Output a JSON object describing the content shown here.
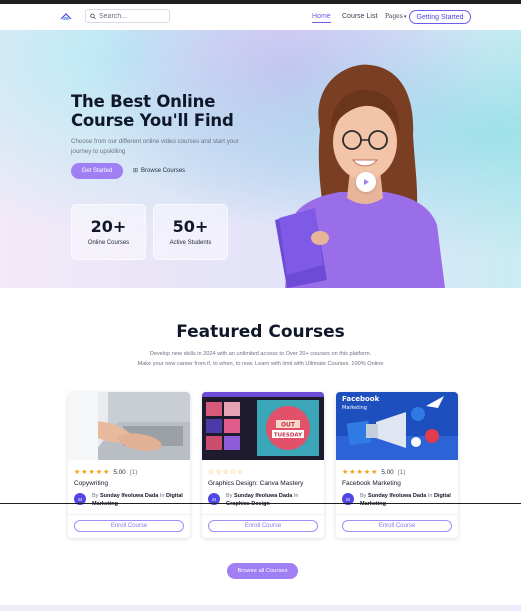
{
  "nav": {
    "search_placeholder": "Search...",
    "links": [
      {
        "label": "Home",
        "active": true
      },
      {
        "label": "Course List",
        "active": false
      }
    ],
    "pages_label": "Pages",
    "get_started_label": "Getting Started"
  },
  "hero": {
    "title": "The Best Online Course You'll Find",
    "subtitle": "Choose from our different online video courses and start your journey to upskilling",
    "primary_button": "Get Started",
    "secondary_link": "Browse Courses",
    "stats": [
      {
        "value": "20+",
        "label": "Online Courses"
      },
      {
        "value": "50+",
        "label": "Active Students"
      }
    ]
  },
  "featured": {
    "title": "Featured Courses",
    "subtitle_line1": "Develop new skills in 2024 with an unlimited access to Over 20+ courses on this platform.",
    "subtitle_line2": "Make your new career from if, to when, to now. Learn with limit with Ultimate Courses. 100% Online",
    "courses": [
      {
        "title": "Copywriting",
        "rating": "5.00",
        "reviews": "(1)",
        "stars": "★★★★★",
        "avatar": "SI",
        "by": "By",
        "author": "Sunday Ifeoluwa Dada",
        "in": "In",
        "category": "Digital Marketing",
        "enroll": "Enroll Course"
      },
      {
        "title": "Graphics Design: Canva Mastery",
        "rating": "",
        "reviews": "",
        "stars": "☆☆☆☆☆",
        "avatar": "SI",
        "by": "By",
        "author": "Sunday Ifeoluwa Dada",
        "in": "In",
        "category": "Graphics Design",
        "enroll": "Enroll Course"
      },
      {
        "title": "Facebook Marketing",
        "rating": "5.00",
        "reviews": "(1)",
        "stars": "★★★★★",
        "avatar": "SI",
        "by": "By",
        "author": "Sunday Ifeoluwa Dada",
        "in": "In",
        "category": "Digital Marketing",
        "enroll": "Enroll Course"
      }
    ],
    "thumb_texts": {
      "canva_out": "OUT",
      "canva_day": "TUESDAY",
      "facebook_word": "Facebook",
      "facebook_sub": "Marketing"
    },
    "browse_all_label": "Browse all Courses"
  },
  "colors": {
    "accent": "#9f7ff3",
    "accent_dark": "#4f46e5",
    "star": "#f59e0b",
    "heading": "#0f1729"
  }
}
